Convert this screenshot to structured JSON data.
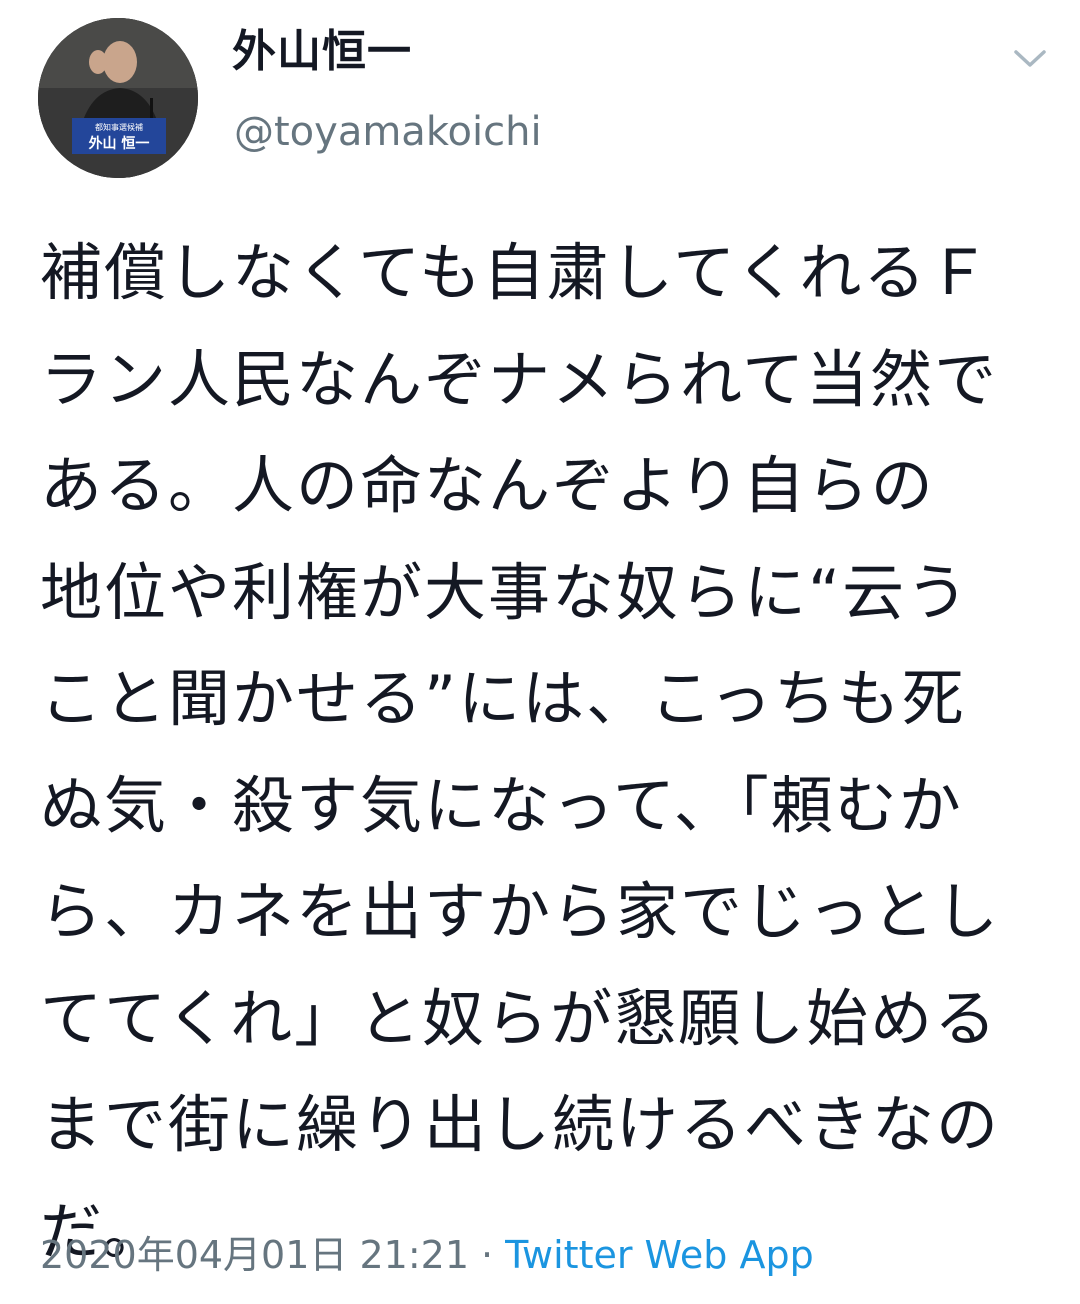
{
  "author": {
    "display_name": "外山恒一",
    "handle": "@toyamakoichi",
    "avatar": {
      "icon": "profile-photo-avatar",
      "nameplate_caption": "都知事選候補",
      "nameplate_name": "外山 恒一"
    }
  },
  "menu": {
    "icon": "chevron-down-icon"
  },
  "tweet": {
    "lines": [
      "補償しなくても自粛してくれるＦ",
      "ラン人民なんぞナメられて当然で",
      "ある。人の命なんぞより自らの",
      "地位や利権が大事な奴らに“云う",
      "こと聞かせる”には、こっちも死",
      "ぬ気・殺す気になって、「頼むか",
      "ら、カネを出すから家でじっとし",
      "ててくれ」と奴らが懇願し始める",
      "まで街に繰り出し続けるべきなの",
      "だ。"
    ]
  },
  "meta": {
    "timestamp": "2020年04月01日 21:21",
    "separator": "·",
    "source": "Twitter Web App"
  },
  "colors": {
    "text": "#141823",
    "secondary": "#66757f",
    "link": "#1b95e0",
    "background": "#ffffff"
  }
}
